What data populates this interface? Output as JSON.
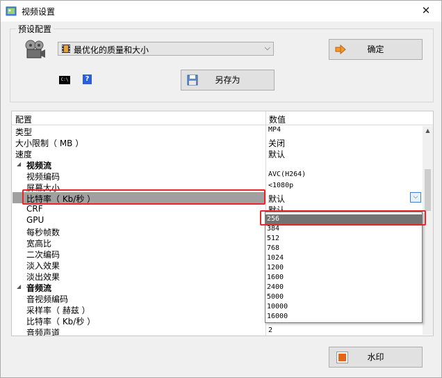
{
  "window": {
    "title": "视频设置",
    "close_glyph": "✕"
  },
  "preset": {
    "group_title": "预设配置",
    "selected": "最优化的质量和大小",
    "ok_label": "确定",
    "save_as_label": "另存为",
    "cmd_icon_text": "C:\\",
    "help_icon_text": "?"
  },
  "grid": {
    "header_name": "配置",
    "header_value": "数值",
    "rows": [
      {
        "name": "类型",
        "value": "MP4"
      },
      {
        "name": "大小限制（ MB ）",
        "value": "关闭"
      },
      {
        "name": "速度",
        "value": "默认"
      },
      {
        "name": "视频流",
        "value": ""
      },
      {
        "name": "视频编码",
        "value": "AVC(H264)"
      },
      {
        "name": "屏幕大小",
        "value": "<1080p"
      },
      {
        "name": "比特率（ Kb/秒 ）",
        "value": "默认"
      },
      {
        "name": "CRF",
        "value": "默认"
      },
      {
        "name": "GPU",
        "value": ""
      },
      {
        "name": "每秒帧数",
        "value": ""
      },
      {
        "name": "宽高比",
        "value": ""
      },
      {
        "name": "二次编码",
        "value": ""
      },
      {
        "name": "淡入效果",
        "value": ""
      },
      {
        "name": "淡出效果",
        "value": ""
      },
      {
        "name": "音频流",
        "value": ""
      },
      {
        "name": "音视频编码",
        "value": ""
      },
      {
        "name": "采样率（ 赫兹 ）",
        "value": ""
      },
      {
        "name": "比特率（ Kb/秒 ）",
        "value": ""
      },
      {
        "name": "音频声道",
        "value": "2"
      }
    ]
  },
  "bitrate_dropdown": {
    "options": [
      "256",
      "384",
      "512",
      "768",
      "1024",
      "1200",
      "1600",
      "2400",
      "5000",
      "10000",
      "16000"
    ],
    "selected": "256"
  },
  "watermark_label": "水印",
  "colors": {
    "highlight_red": "#e8262b",
    "selection_gray": "#a0a0a0",
    "dropdown_selected": "#737373"
  }
}
